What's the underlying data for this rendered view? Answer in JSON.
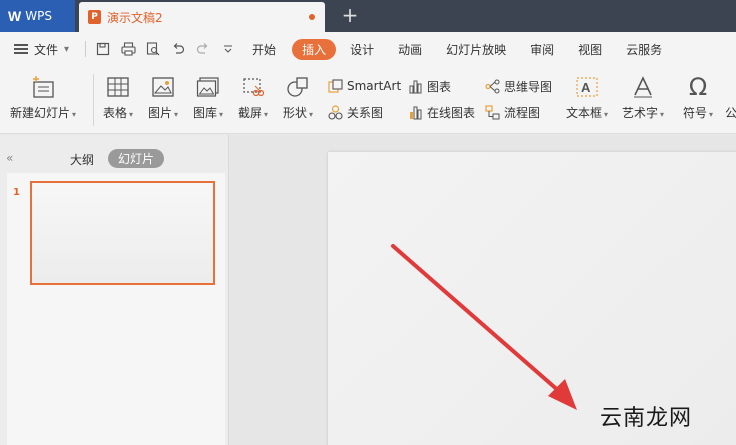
{
  "app": {
    "name": "WPS",
    "doc_tab": "演示文稿2"
  },
  "menu": {
    "file": "文件",
    "tabs": [
      "开始",
      "插入",
      "设计",
      "动画",
      "幻灯片放映",
      "审阅",
      "视图",
      "云服务"
    ],
    "active_tab": "插入"
  },
  "ribbon": {
    "new_slide": "新建幻灯片",
    "table": "表格",
    "picture": "图片",
    "gallery": "图库",
    "screenshot": "截屏",
    "shape": "形状",
    "smartart": "SmartArt",
    "relation": "关系图",
    "chart": "图表",
    "online_chart": "在线图表",
    "mindmap": "思维导图",
    "flowchart": "流程图",
    "textbox": "文本框",
    "wordart": "艺术字",
    "symbol": "符号",
    "formula": "公"
  },
  "left_panel": {
    "outline": "大纲",
    "slides": "幻灯片",
    "slide_number": "1"
  },
  "watermark": "云南龙网",
  "colors": {
    "accent": "#e8703a",
    "wps_blue": "#2b5fb4",
    "titlebar": "#3d4451",
    "arrow": "#e03a3a"
  }
}
